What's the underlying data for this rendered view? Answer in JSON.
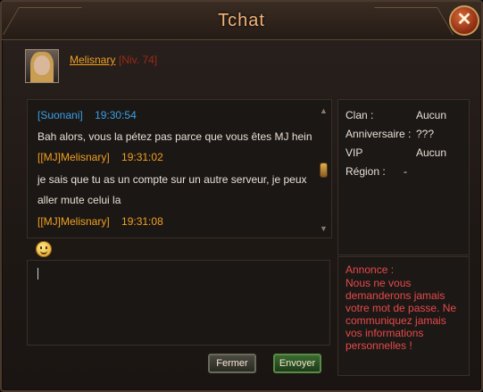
{
  "window": {
    "title": "Tchat",
    "close_label": "✕"
  },
  "user": {
    "name": "Melisnary",
    "level": "[Niv. 74]"
  },
  "messages": [
    {
      "sender": "[Suonani]",
      "time": "19:30:54",
      "text": "Bah alors, vous la pétez pas parce que vous êtes MJ hein"
    },
    {
      "sender": "[[MJ]Melisnary]",
      "time": "19:31:02",
      "text_lines": [
        "je sais que tu as un compte sur un autre serveur, je peux",
        "aller mute celui la"
      ]
    },
    {
      "sender": "[[MJ]Melisnary]",
      "time": "19:31:08"
    }
  ],
  "input": {
    "value": ""
  },
  "info": {
    "clan_label": "Clan :",
    "clan_value": "Aucun",
    "anniversaire_label": "Anniversaire :",
    "anniversaire_value": "???",
    "vip_label": "VIP",
    "vip_value": "Aucun",
    "region_label": "Région :",
    "region_value": "-"
  },
  "notice": {
    "title": "Annonce :",
    "text": "Nous ne vous demanderons jamais votre mot de passe. Ne communiquez jamais vos informations personnelles !"
  },
  "buttons": {
    "close_label": "Fermer",
    "send_label": "Envoyer"
  },
  "colors": {
    "title": "#f3b27a",
    "username": "#f0a020",
    "timestamp_blue": "#3aa0e6",
    "notice_red": "#e64a4a"
  },
  "icons": [
    "close-icon",
    "emoji-icon",
    "scroll-up-icon",
    "scroll-down-icon"
  ]
}
